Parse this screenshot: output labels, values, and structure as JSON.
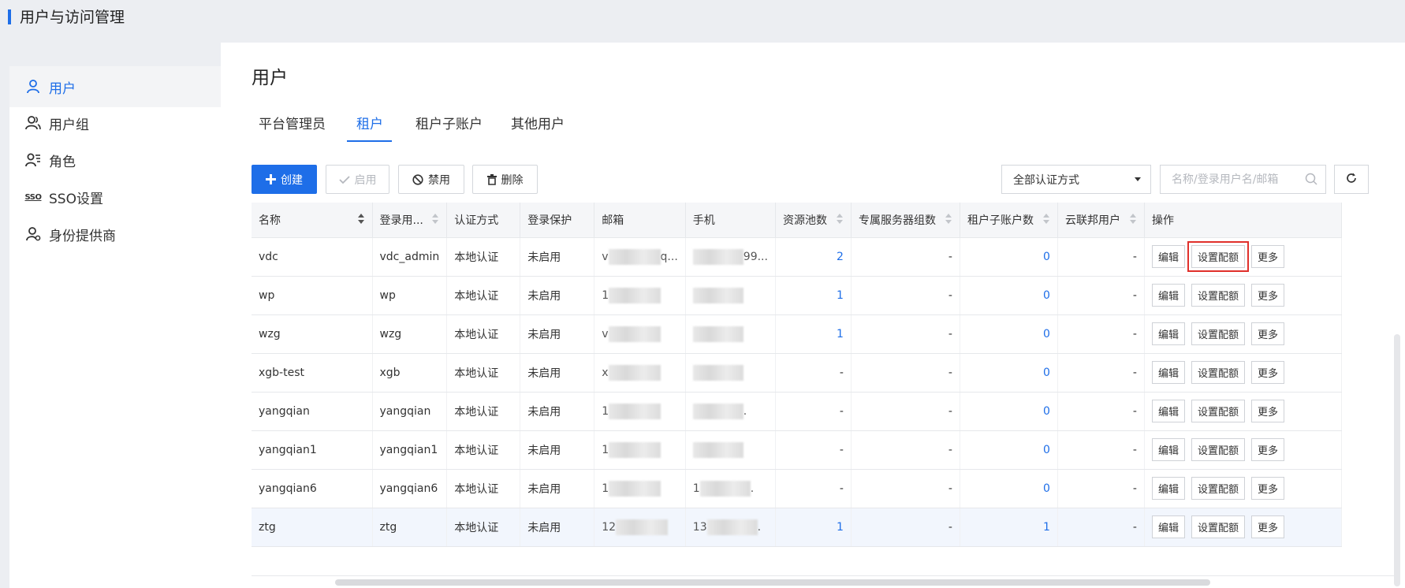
{
  "header": {
    "title": "用户与访问管理"
  },
  "sidebar": {
    "items": [
      {
        "label": "用户",
        "icon": "user-icon",
        "active": true
      },
      {
        "label": "用户组",
        "icon": "user-group-icon",
        "active": false
      },
      {
        "label": "角色",
        "icon": "role-icon",
        "active": false
      },
      {
        "label": "SSO设置",
        "icon": "sso-icon",
        "active": false
      },
      {
        "label": "身份提供商",
        "icon": "identity-provider-icon",
        "active": false
      }
    ]
  },
  "main": {
    "title": "用户",
    "tabs": [
      {
        "label": "平台管理员",
        "active": false
      },
      {
        "label": "租户",
        "active": true
      },
      {
        "label": "租户子账户",
        "active": false
      },
      {
        "label": "其他用户",
        "active": false
      }
    ],
    "toolbar": {
      "create": "创建",
      "enable": "启用",
      "disable": "禁用",
      "delete": "删除",
      "auth_filter": "全部认证方式",
      "search_placeholder": "名称/登录用户名/邮箱"
    },
    "table": {
      "columns": [
        "名称",
        "登录用...",
        "认证方式",
        "登录保护",
        "邮箱",
        "手机",
        "资源池数",
        "专属服务器组数",
        "租户子账户数",
        "云联邦用户",
        "操作"
      ],
      "rows": [
        {
          "name": "vdc",
          "login": "vdc_admin",
          "auth": "本地认证",
          "protect": "未启用",
          "email_prefix": "v",
          "email_suffix": "q...",
          "phone_prefix": "",
          "phone_suffix": "99...",
          "pools": "2",
          "servers": "-",
          "subaccounts": "0",
          "federated": "-"
        },
        {
          "name": "wp",
          "login": "wp",
          "auth": "本地认证",
          "protect": "未启用",
          "email_prefix": "1",
          "email_suffix": "",
          "phone_prefix": "",
          "phone_suffix": "",
          "pools": "1",
          "servers": "-",
          "subaccounts": "0",
          "federated": "-"
        },
        {
          "name": "wzg",
          "login": "wzg",
          "auth": "本地认证",
          "protect": "未启用",
          "email_prefix": "v",
          "email_suffix": "",
          "phone_prefix": "",
          "phone_suffix": "",
          "pools": "1",
          "servers": "-",
          "subaccounts": "0",
          "federated": "-"
        },
        {
          "name": "xgb-test",
          "login": "xgb",
          "auth": "本地认证",
          "protect": "未启用",
          "email_prefix": "x",
          "email_suffix": "",
          "phone_prefix": "",
          "phone_suffix": "",
          "pools": "-",
          "servers": "-",
          "subaccounts": "0",
          "federated": "-"
        },
        {
          "name": "yangqian",
          "login": "yangqian",
          "auth": "本地认证",
          "protect": "未启用",
          "email_prefix": "1",
          "email_suffix": "",
          "phone_prefix": "",
          "phone_suffix": ".",
          "pools": "-",
          "servers": "-",
          "subaccounts": "0",
          "federated": "-"
        },
        {
          "name": "yangqian1",
          "login": "yangqian1",
          "auth": "本地认证",
          "protect": "未启用",
          "email_prefix": "1",
          "email_suffix": "",
          "phone_prefix": "",
          "phone_suffix": "",
          "pools": "-",
          "servers": "-",
          "subaccounts": "0",
          "federated": "-"
        },
        {
          "name": "yangqian6",
          "login": "yangqian6",
          "auth": "本地认证",
          "protect": "未启用",
          "email_prefix": "1",
          "email_suffix": "",
          "phone_prefix": "1",
          "phone_suffix": ".",
          "pools": "-",
          "servers": "-",
          "subaccounts": "0",
          "federated": "-"
        },
        {
          "name": "ztg",
          "login": "ztg",
          "auth": "本地认证",
          "protect": "未启用",
          "email_prefix": "12",
          "email_suffix": "",
          "phone_prefix": "13",
          "phone_suffix": ".",
          "pools": "1",
          "servers": "-",
          "subaccounts": "1",
          "federated": "-"
        }
      ],
      "actions": {
        "edit": "编辑",
        "quota": "设置配额",
        "more": "更多"
      }
    }
  },
  "colors": {
    "accent": "#1e6ee8",
    "highlight_box": "#e0302b"
  }
}
